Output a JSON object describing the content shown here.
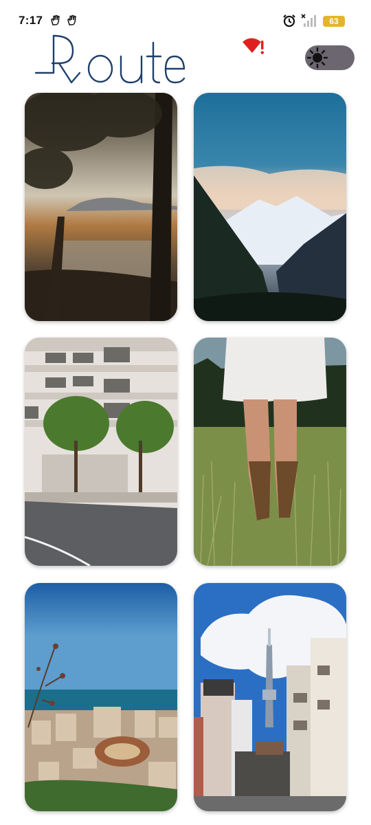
{
  "status_bar": {
    "time": "7:17",
    "battery": "63",
    "icons": [
      "hand-notification-icon",
      "hand-notification-icon",
      "alarm-icon",
      "no-signal-icon",
      "battery-icon"
    ]
  },
  "header": {
    "logo_text": "Route",
    "alert_icon": "red-wifi-alert-icon",
    "theme_toggle_icon": "sun-icon"
  },
  "gallery": {
    "items": [
      {
        "name": "forest-lake-photo"
      },
      {
        "name": "snowy-mountain-photo"
      },
      {
        "name": "building-street-photo"
      },
      {
        "name": "grass-field-photo"
      },
      {
        "name": "coastal-city-photo"
      },
      {
        "name": "tokyo-street-photo"
      }
    ]
  },
  "colors": {
    "logo": "#1f3f6b",
    "accent": "#e02020",
    "toggle": "#6b6670",
    "battery": "#e3b52b"
  }
}
